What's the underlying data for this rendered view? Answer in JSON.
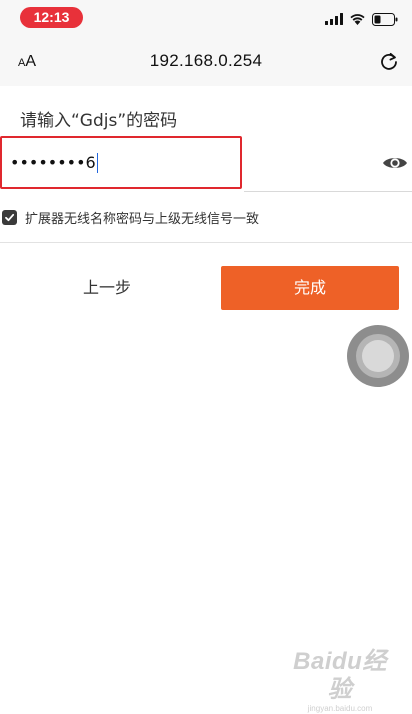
{
  "status_bar": {
    "time": "12:13",
    "icons": [
      "cellular-signal-icon",
      "wifi-icon",
      "battery-icon"
    ]
  },
  "browser": {
    "text_size_button": {
      "small": "A",
      "large": "A"
    },
    "url": "192.168.0.254",
    "reload_icon": "reload-icon"
  },
  "form": {
    "prompt": "请输入“Gdjs”的密码",
    "password_masked": "••••••••",
    "password_last_char": "6",
    "show_password_icon": "eye-icon",
    "sync_checkbox": {
      "checked": true,
      "label": "扩展器无线名称密码与上级无线信号一致"
    }
  },
  "actions": {
    "prev_label": "上一步",
    "finish_label": "完成"
  },
  "colors": {
    "status_time_pill": "#e8313a",
    "field_highlight": "#e0282e",
    "primary_button": "#ee6127",
    "caret": "#2266dd"
  },
  "watermark": {
    "logo": "Baidu经验",
    "url": "jingyan.baidu.com"
  }
}
